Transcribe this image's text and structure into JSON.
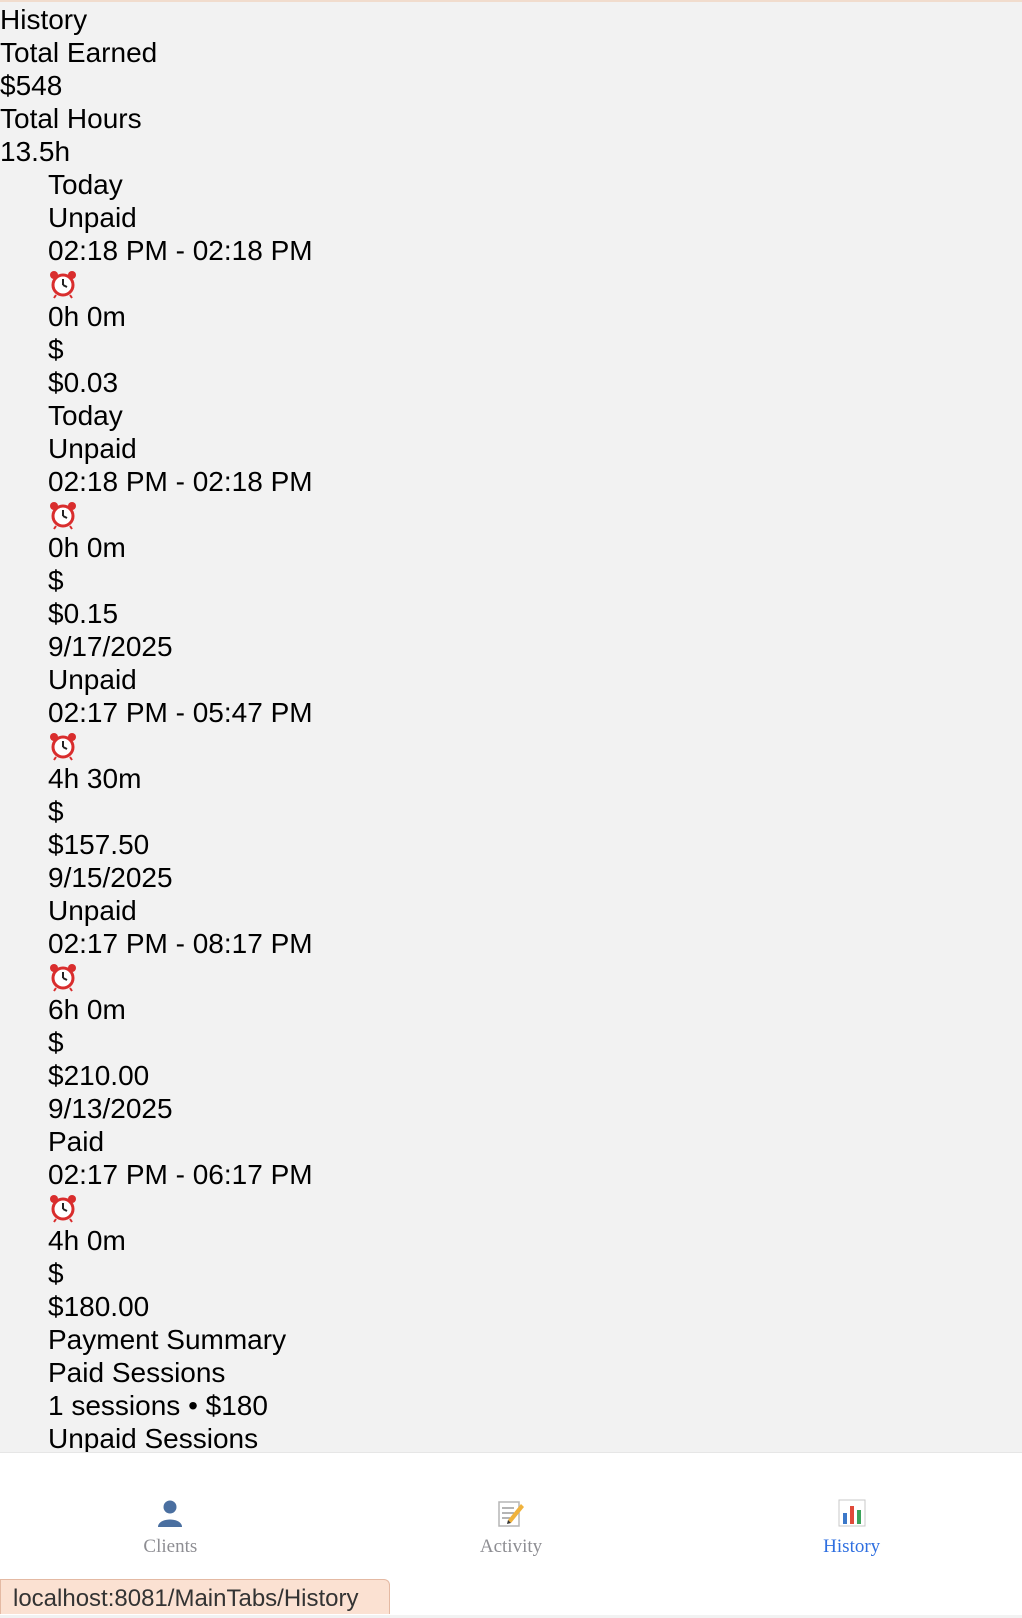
{
  "header": {
    "title": "History",
    "total_earned_label": "Total Earned",
    "total_earned_value": "$548",
    "total_hours_label": "Total Hours",
    "total_hours_value": "13.5h"
  },
  "sessions": [
    {
      "date": "Today",
      "status": "Unpaid",
      "time_range": "02:18 PM - 02:18 PM",
      "duration": "0h 0m",
      "currency_symbol": "$",
      "amount": "$0.03"
    },
    {
      "date": "Today",
      "status": "Unpaid",
      "time_range": "02:18 PM - 02:18 PM",
      "duration": "0h 0m",
      "currency_symbol": "$",
      "amount": "$0.15"
    },
    {
      "date": "9/17/2025",
      "status": "Unpaid",
      "time_range": "02:17 PM - 05:47 PM",
      "duration": "4h 30m",
      "currency_symbol": "$",
      "amount": "$157.50"
    },
    {
      "date": "9/15/2025",
      "status": "Unpaid",
      "time_range": "02:17 PM - 08:17 PM",
      "duration": "6h 0m",
      "currency_symbol": "$",
      "amount": "$210.00"
    },
    {
      "date": "9/13/2025",
      "status": "Paid",
      "time_range": "02:17 PM - 06:17 PM",
      "duration": "4h 0m",
      "currency_symbol": "$",
      "amount": "$180.00"
    }
  ],
  "payment_summary": {
    "title": "Payment Summary",
    "paid_label": "Paid Sessions",
    "paid_value": "1 sessions • $180",
    "unpaid_label": "Unpaid Sessions"
  },
  "tabs": [
    {
      "label": "Clients",
      "icon": "person-icon",
      "active": false
    },
    {
      "label": "Activity",
      "icon": "memo-icon",
      "active": false
    },
    {
      "label": "History",
      "icon": "bar-chart-icon",
      "active": true
    }
  ],
  "status_bar": {
    "url": "localhost:8081/MainTabs/History"
  },
  "colors": {
    "background": "#f2f2f2",
    "tab_active": "#2f6fe0",
    "tab_inactive": "#8e8e93"
  }
}
